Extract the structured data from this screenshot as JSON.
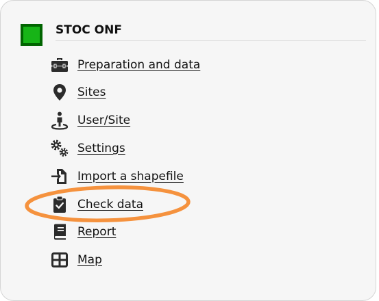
{
  "module": {
    "title": "STOC ONF",
    "icon": "green-square-icon",
    "icon_color": "#17b417",
    "icon_border_color": "#006400"
  },
  "menu": {
    "items": [
      {
        "label": "Preparation and data",
        "icon": "toolbox-icon"
      },
      {
        "label": "Sites",
        "icon": "map-marker-icon"
      },
      {
        "label": "User/Site",
        "icon": "person-pin-icon"
      },
      {
        "label": "Settings",
        "icon": "gears-icon"
      },
      {
        "label": "Import a shapefile",
        "icon": "file-import-icon"
      },
      {
        "label": "Check data",
        "icon": "clipboard-check-icon",
        "highlighted": true
      },
      {
        "label": "Report",
        "icon": "book-icon"
      },
      {
        "label": "Map",
        "icon": "grid-icon"
      }
    ]
  },
  "colors": {
    "panel_background": "#f6f6f6",
    "panel_border": "#d4d4d4",
    "text": "#111111",
    "icon": "#2b2b2b",
    "highlight": "#f5923e"
  }
}
